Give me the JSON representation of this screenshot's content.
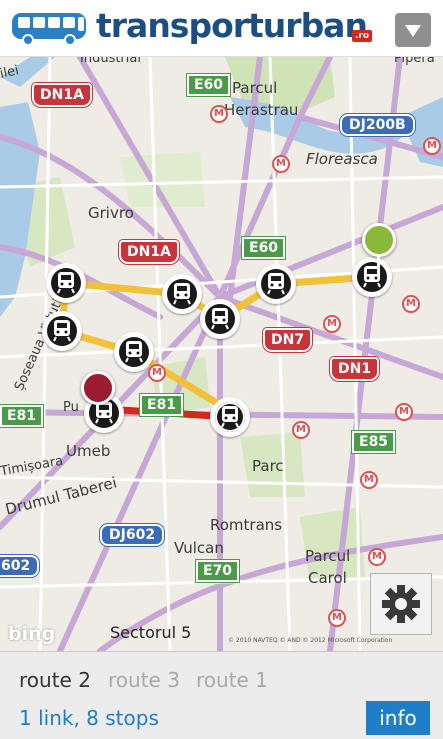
{
  "header": {
    "brand_part1": "transport",
    "brand_part2": "urban",
    "brand_suffix": ".ro",
    "menu_icon": "triangle-down-icon",
    "logo_icon": "bus-icon"
  },
  "map": {
    "districts": [
      "Parcul",
      "Herastrau",
      "Floreasca",
      "Grivro",
      "Parc",
      "Umeb",
      "Romtrans",
      "Vulcan",
      "Parcul",
      "Carol",
      "Sectorul 5",
      "Drumul Taberei",
      "Timișoara",
      "Șoseaua Virtutii",
      "Pu",
      "Industrial",
      "Piperă",
      "ilei"
    ],
    "roads": {
      "red": [
        "DN1A",
        "DN1A",
        "DN7",
        "DN1"
      ],
      "green": [
        "E60",
        "E60",
        "E81",
        "E81",
        "E85",
        "E70"
      ],
      "blue": [
        "DJ200B",
        "DJ602",
        "602"
      ]
    },
    "attribution_logo": "bing",
    "copyright": "© 2010 NAVTEQ   © AND   © 2012 Microsoft Corporation",
    "route_colors": {
      "primary": "#f2c13a",
      "active": "#d8261c"
    },
    "start_pin_color": "#8ab93a",
    "end_pin_color": "#9b1b30",
    "settings_icon": "gear-icon",
    "stop_icon": "train-icon"
  },
  "footer": {
    "tabs": [
      {
        "label": "route 2",
        "active": true
      },
      {
        "label": "route 3",
        "active": false
      },
      {
        "label": "route 1",
        "active": false
      }
    ],
    "summary": "1 link, 8 stops",
    "info_button": "info"
  }
}
